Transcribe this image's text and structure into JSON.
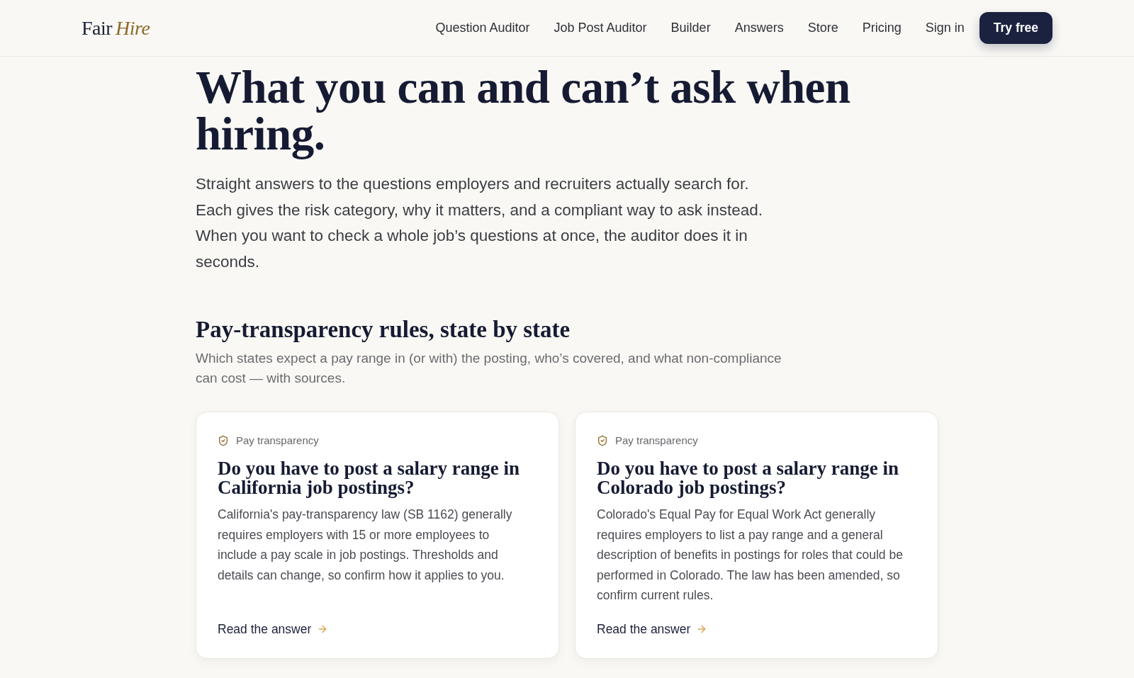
{
  "header": {
    "logo": {
      "word": "Fair",
      "accent": "Hire"
    },
    "nav": [
      {
        "label": "Question Auditor"
      },
      {
        "label": "Job Post Auditor"
      },
      {
        "label": "Builder"
      },
      {
        "label": "Answers"
      },
      {
        "label": "Store"
      },
      {
        "label": "Pricing"
      },
      {
        "label": "Sign in"
      }
    ],
    "cta": "Try free"
  },
  "hero": {
    "title": "What you can and can’t ask when hiring.",
    "intro": "Straight answers to the questions employers and recruiters actually search for. Each gives the risk category, why it matters, and a compliant way to ask instead. When you want to check a whole job’s questions at once, the auditor does it in seconds."
  },
  "section": {
    "title": "Pay-transparency rules, state by state",
    "subtitle": "Which states expect a pay range in (or with) the posting, who’s covered, and what non-compliance can cost — with sources.",
    "cards": [
      {
        "tag": "Pay transparency",
        "title": "Do you have to post a salary range in California job postings?",
        "body": "California's pay-transparency law (SB 1162) generally requires employers with 15 or more employees to include a pay scale in job postings. Thresholds and details can change, so confirm how it applies to you.",
        "link": "Read the answer"
      },
      {
        "tag": "Pay transparency",
        "title": "Do you have to post a salary range in Colorado job postings?",
        "body": "Colorado's Equal Pay for Equal Work Act generally requires employers to list a pay range and a general description of benefits in postings for roles that could be performed in Colorado. The law has been amended, so confirm current rules.",
        "link": "Read the answer"
      }
    ]
  }
}
